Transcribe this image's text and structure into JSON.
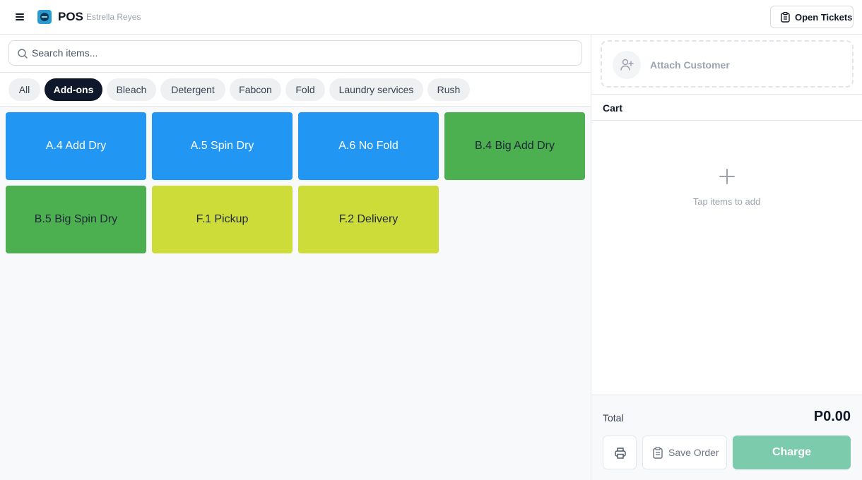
{
  "header": {
    "app_title": "POS",
    "user_name": "Estrella Reyes",
    "open_tickets_label": "Open Tickets"
  },
  "search": {
    "placeholder": "Search items...",
    "value": ""
  },
  "categories": [
    {
      "label": "All",
      "active": false
    },
    {
      "label": "Add-ons",
      "active": true
    },
    {
      "label": "Bleach",
      "active": false
    },
    {
      "label": "Detergent",
      "active": false
    },
    {
      "label": "Fabcon",
      "active": false
    },
    {
      "label": "Fold",
      "active": false
    },
    {
      "label": "Laundry services",
      "active": false
    },
    {
      "label": "Rush",
      "active": false
    }
  ],
  "items": [
    {
      "label": "A.4 Add Dry",
      "color": "#2196f3",
      "text_color": "#ffffff"
    },
    {
      "label": "A.5 Spin Dry",
      "color": "#2196f3",
      "text_color": "#ffffff"
    },
    {
      "label": "A.6 No Fold",
      "color": "#2196f3",
      "text_color": "#ffffff"
    },
    {
      "label": "B.4 Big Add Dry",
      "color": "#4caf50",
      "text_color": "#1f2937"
    },
    {
      "label": "B.5 Big Spin Dry",
      "color": "#4caf50",
      "text_color": "#1f2937"
    },
    {
      "label": "F.1 Pickup",
      "color": "#cddc39",
      "text_color": "#1f2937"
    },
    {
      "label": "F.2 Delivery",
      "color": "#cddc39",
      "text_color": "#1f2937"
    }
  ],
  "customer": {
    "attach_label": "Attach Customer"
  },
  "cart": {
    "title": "Cart",
    "empty_text": "Tap items to add"
  },
  "footer": {
    "total_label": "Total",
    "total_value": "P0.00",
    "save_label": "Save Order",
    "charge_label": "Charge"
  },
  "colors": {
    "accent_dark": "#0f172a",
    "charge_disabled": "#7ccbac"
  },
  "icons": {
    "menu": "hamburger-menu-icon",
    "logo": "pos-logo-icon",
    "tickets": "clipboard-icon",
    "search": "search-icon",
    "customer": "user-plus-icon",
    "empty": "plus-icon",
    "print": "printer-icon",
    "save": "clipboard-icon"
  }
}
